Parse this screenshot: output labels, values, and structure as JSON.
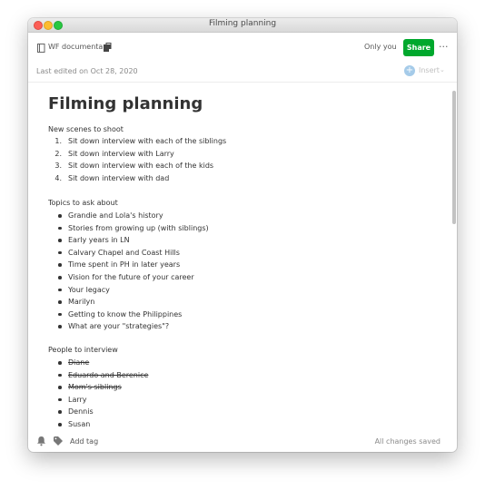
{
  "window": {
    "title": "Filming planning"
  },
  "toolbar": {
    "notebook_name": "WF documentary",
    "notebook_icon": "notebook-icon",
    "doc_icon": "document-stack-icon",
    "sharing_status": "Only you",
    "share_label": "Share",
    "more_label": "···",
    "share_color": "#00a82d"
  },
  "meta": {
    "last_edited": "Last edited on Oct 28, 2020",
    "insert_label": "Insert",
    "insert_plus": "+",
    "insert_caret": "⌄"
  },
  "note": {
    "title": "Filming planning",
    "sections": [
      {
        "heading": "New scenes to shoot",
        "list_type": "ordered",
        "items": [
          {
            "number": "1.",
            "text": "Sit down interview with each of the siblings"
          },
          {
            "number": "2.",
            "text": "Sit down interview with Larry"
          },
          {
            "number": "3.",
            "text": "Sit down interview with each of the kids"
          },
          {
            "number": "4.",
            "text": "Sit down interview with dad"
          }
        ]
      },
      {
        "heading": "Topics to ask about",
        "list_type": "bullet",
        "items": [
          {
            "text": "Grandie and Lola's history"
          },
          {
            "text": "Stories from growing up (with siblings)"
          },
          {
            "text": "Early years in LN"
          },
          {
            "text": "Calvary Chapel and Coast Hills"
          },
          {
            "text": "Time spent in PH in later years"
          },
          {
            "text": "Vision for the future of your career"
          },
          {
            "text": "Your legacy"
          },
          {
            "text": "Marilyn"
          },
          {
            "text": "Getting to know the Philippines"
          },
          {
            "text": "What are your \"strategies\"?"
          }
        ]
      },
      {
        "heading": "People to interview",
        "list_type": "bullet",
        "items": [
          {
            "text": "Diane",
            "struck": true
          },
          {
            "text": "Eduardo and Berenice",
            "struck": true
          },
          {
            "text": "Mom's siblings",
            "struck": true
          },
          {
            "text": "Larry",
            "struck": false
          },
          {
            "text": "Dennis",
            "struck": false
          },
          {
            "text": "Susan",
            "struck": false
          }
        ]
      }
    ]
  },
  "footer": {
    "add_tag_label": "Add tag",
    "save_status": "All changes saved",
    "reminder_icon": "bell-icon",
    "tag_icon": "tag-icon"
  }
}
